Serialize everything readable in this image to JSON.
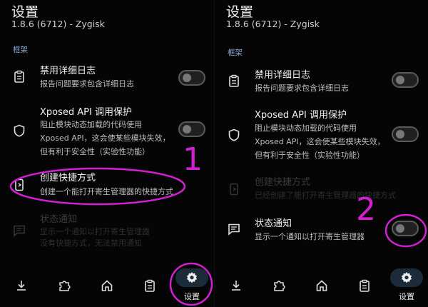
{
  "panels": [
    {
      "title": "设置",
      "version": "1.8.6 (6712) - Zygisk",
      "section": "框架",
      "rows": [
        {
          "title": "禁用详细日志",
          "subtitle": [
            "报告问题要求包含详细日志"
          ]
        },
        {
          "title": "Xposed API 调用保护",
          "subtitle": [
            "阻止模块动态加载的代码使用",
            "Xposed API，这会使某些模块失效，",
            "但有利于安全性（实验性功能）"
          ]
        },
        {
          "title": "创建快捷方式",
          "subtitle": [
            "创建一个能打开寄生管理器的快捷方式"
          ]
        },
        {
          "title": "状态通知",
          "subtitle": [
            "显示一个通知以打开寄生管理器",
            "没有快捷方式，无法禁用通知"
          ]
        }
      ],
      "nav": {
        "active_label": "设置"
      },
      "annotation_number": "1"
    },
    {
      "title": "设置",
      "version": "1.8.6 (6712) - Zygisk",
      "section": "框架",
      "rows": [
        {
          "title": "禁用详细日志",
          "subtitle": [
            "报告问题要求包含详细日志"
          ]
        },
        {
          "title": "Xposed API 调用保护",
          "subtitle": [
            "阻止模块动态加载的代码使用",
            "Xposed API，这会使某些模块失效，",
            "但有利于安全性（实验性功能）"
          ]
        },
        {
          "title": "创建快捷方式",
          "subtitle": [
            "已经创建了能打开寄生管理器的快捷方式"
          ]
        },
        {
          "title": "状态通知",
          "subtitle": [
            "显示一个通知以打开寄生管理器"
          ]
        }
      ],
      "nav": {
        "active_label": "设置"
      },
      "annotation_number": "2"
    }
  ],
  "icons": {
    "verbose_log": "clipboard-icon",
    "api_protection": "shield-icon",
    "shortcut": "phone-shortcut-icon",
    "notification": "message-icon",
    "nav": [
      "download-icon",
      "puzzle-icon",
      "home-icon",
      "clipboard-icon",
      "gear-icon"
    ]
  },
  "colors": {
    "annotation": "#d21fd2",
    "section": "#86a8cf",
    "nav_pill": "#1c2b3a"
  }
}
